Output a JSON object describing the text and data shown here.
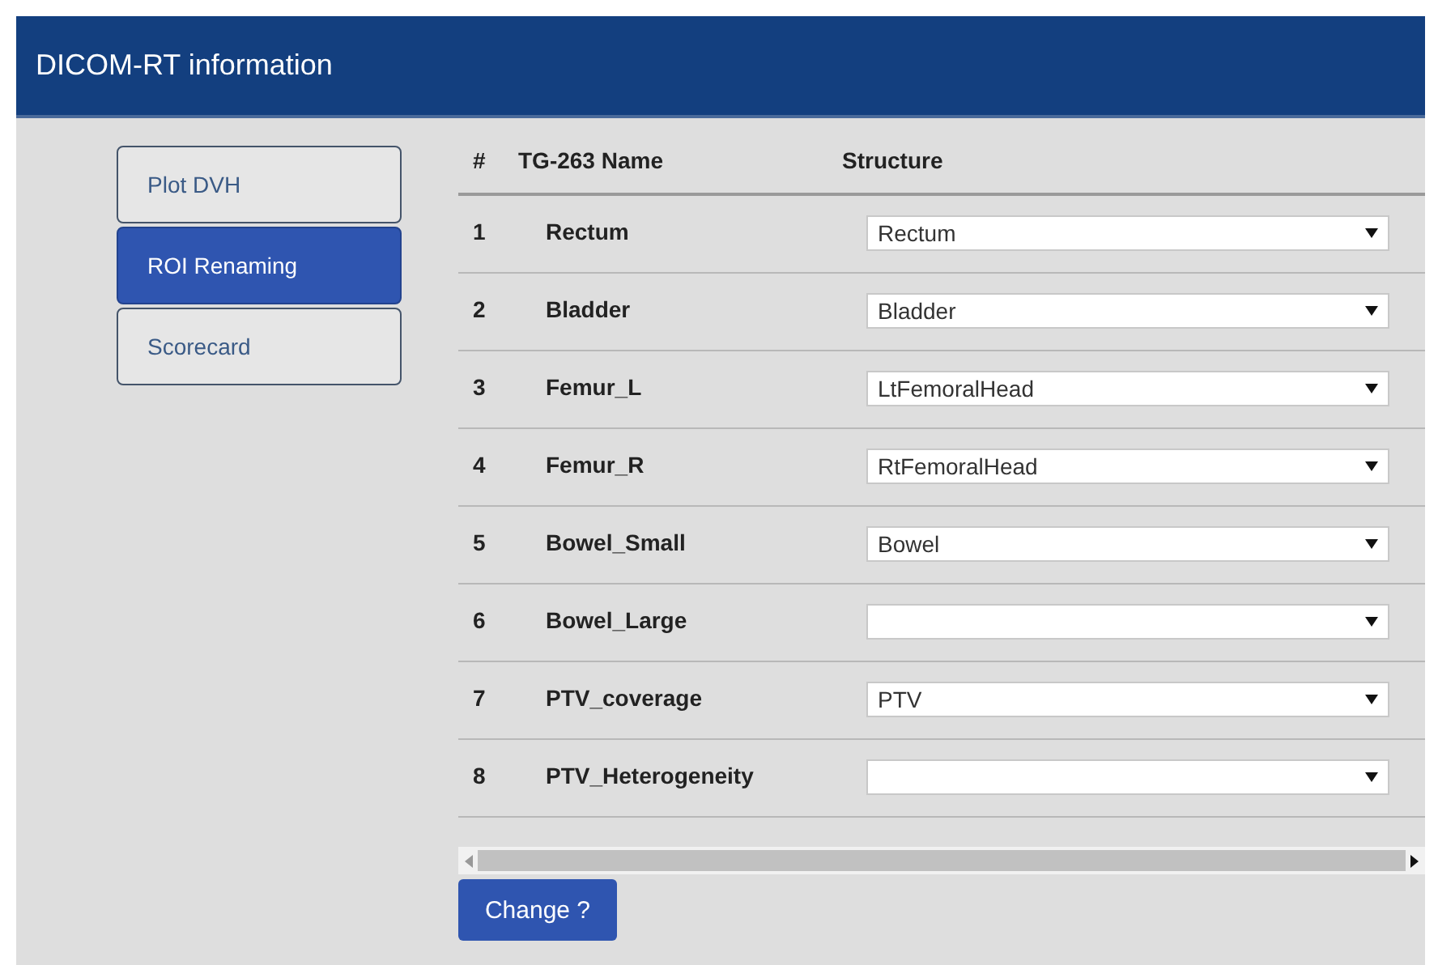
{
  "header": {
    "title": "DICOM-RT information"
  },
  "nav": [
    {
      "label": "Plot DVH",
      "selected": false
    },
    {
      "label": "ROI Renaming",
      "selected": true
    },
    {
      "label": "Scorecard",
      "selected": false
    }
  ],
  "table": {
    "columns": [
      "#",
      "TG-263 Name",
      "Structure"
    ],
    "rows": [
      {
        "index": "1",
        "name": "Rectum",
        "structure": "Rectum"
      },
      {
        "index": "2",
        "name": "Bladder",
        "structure": "Bladder"
      },
      {
        "index": "3",
        "name": "Femur_L",
        "structure": "LtFemoralHead"
      },
      {
        "index": "4",
        "name": "Femur_R",
        "structure": "RtFemoralHead"
      },
      {
        "index": "5",
        "name": "Bowel_Small",
        "structure": "Bowel"
      },
      {
        "index": "6",
        "name": "Bowel_Large",
        "structure": ""
      },
      {
        "index": "7",
        "name": "PTV_coverage",
        "structure": "PTV"
      },
      {
        "index": "8",
        "name": "PTV_Heterogeneity",
        "structure": ""
      }
    ]
  },
  "button": {
    "label": "Change ?"
  }
}
